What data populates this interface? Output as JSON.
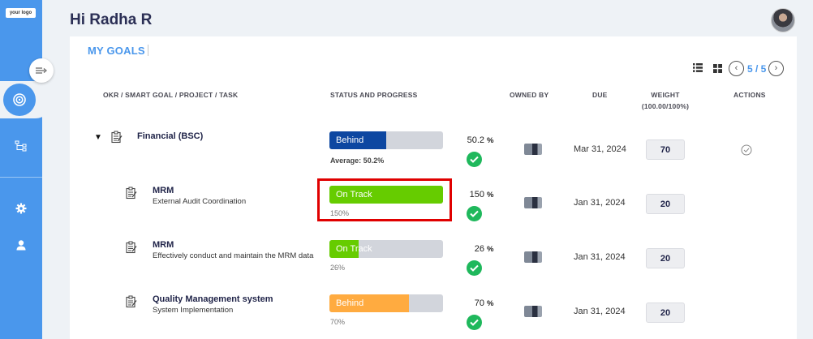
{
  "app": {
    "logo_text": "your logo"
  },
  "header": {
    "greeting": "Hi Radha R"
  },
  "tabs": {
    "my_goals": "MY GOALS"
  },
  "pagination": {
    "text": "5 / 5"
  },
  "columns": {
    "goal": "OKR / SMART GOAL / PROJECT / TASK",
    "status": "STATUS AND PROGRESS",
    "owned_by": "OWNED BY",
    "due": "DUE",
    "weight": "WEIGHT",
    "weight_sub": "(100.00/100%)",
    "actions": "ACTIONS"
  },
  "rows": [
    {
      "title": "Financial (BSC)",
      "subtitle": "",
      "status": "Behind",
      "progress_pct": 50.2,
      "caption": "Average: 50.2%",
      "pct_value": "50.2",
      "pct_sign": "%",
      "due": "Mar 31, 2024",
      "weight": "70",
      "status_color": "#0d47a1"
    },
    {
      "title": "MRM",
      "subtitle": "External Audit Coordination",
      "status": "On Track",
      "progress_pct": 100,
      "caption": "150%",
      "pct_value": "150",
      "pct_sign": "%",
      "due": "Jan 31, 2024",
      "weight": "20",
      "status_color": "#66cc00"
    },
    {
      "title": "MRM",
      "subtitle": "Effectively conduct and maintain the MRM data",
      "status": "On Track",
      "progress_pct": 26,
      "caption": "26%",
      "pct_value": "26",
      "pct_sign": "%",
      "due": "Jan 31, 2024",
      "weight": "20",
      "status_color": "#66cc00"
    },
    {
      "title": "Quality Management system",
      "subtitle": "System Implementation",
      "status": "Behind",
      "progress_pct": 70,
      "caption": "70%",
      "pct_value": "70",
      "pct_sign": "%",
      "due": "Jan 31, 2024",
      "weight": "20",
      "status_color": "#ffab40"
    }
  ],
  "colors": {
    "sidebar": "#4a97ec",
    "accent": "#4a97ec",
    "check": "#1fb85c",
    "highlight": "#e00000"
  },
  "icons": [
    "collapse-icon",
    "target-icon",
    "hierarchy-icon",
    "settings-icon",
    "user-icon",
    "list-view-icon",
    "grid-view-icon",
    "chevron-left-icon",
    "chevron-right-icon",
    "task-icon",
    "check-icon",
    "circle-check-icon"
  ]
}
